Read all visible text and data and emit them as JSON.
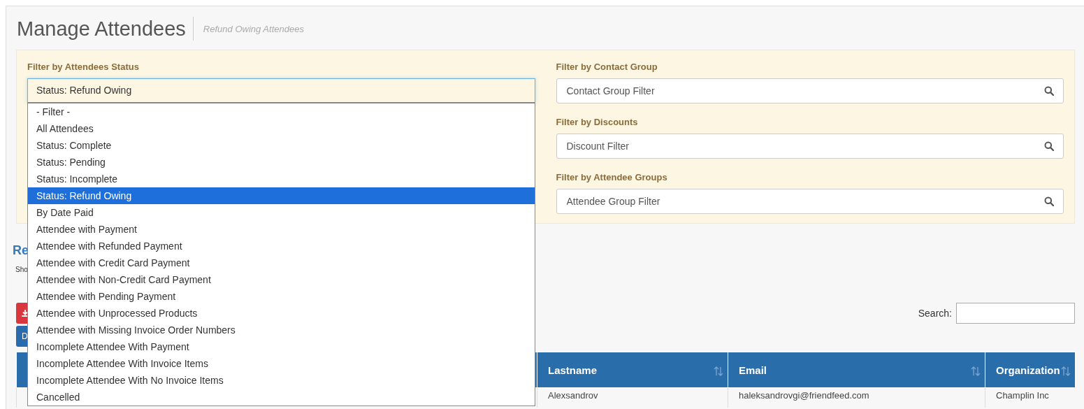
{
  "header": {
    "title": "Manage Attendees",
    "subtitle": "Refund Owing Attendees"
  },
  "filters": {
    "status": {
      "label": "Filter by Attendees Status",
      "value": "Status: Refund Owing",
      "expanded": true,
      "options": [
        {
          "label": "- Filter -",
          "selected": false
        },
        {
          "label": "All Attendees",
          "selected": false
        },
        {
          "label": "Status: Complete",
          "selected": false
        },
        {
          "label": "Status: Pending",
          "selected": false
        },
        {
          "label": "Status: Incomplete",
          "selected": false
        },
        {
          "label": "Status: Refund Owing",
          "selected": true
        },
        {
          "label": "By Date Paid",
          "selected": false
        },
        {
          "label": "Attendee with Payment",
          "selected": false
        },
        {
          "label": "Attendee with Refunded Payment",
          "selected": false
        },
        {
          "label": "Attendee with Credit Card Payment",
          "selected": false
        },
        {
          "label": "Attendee with Non-Credit Card Payment",
          "selected": false
        },
        {
          "label": "Attendee with Pending Payment",
          "selected": false
        },
        {
          "label": "Attendee with Unprocessed Products",
          "selected": false
        },
        {
          "label": "Attendee with Missing Invoice Order Numbers",
          "selected": false
        },
        {
          "label": "Incomplete Attendee With Payment",
          "selected": false
        },
        {
          "label": "Incomplete Attendee With Invoice Items",
          "selected": false
        },
        {
          "label": "Incomplete Attendee With No Invoice Items",
          "selected": false
        },
        {
          "label": "Cancelled",
          "selected": false
        }
      ]
    },
    "search_filters": [
      {
        "label": "Filter by Contact Group",
        "placeholder": "Contact Group Filter"
      },
      {
        "label": "Filter by Discounts",
        "placeholder": "Discount Filter"
      },
      {
        "label": "Filter by Attendee Groups",
        "placeholder": "Attendee Group Filter"
      }
    ]
  },
  "results": {
    "heading": "Re",
    "show_text": "Sho",
    "buttons": [
      {
        "kind": "danger"
      },
      {
        "kind": "primary",
        "label": "D"
      }
    ],
    "search_label": "Search:"
  },
  "table": {
    "columns": [
      "Lastname",
      "Email",
      "Organization"
    ],
    "rows": [
      {
        "cells": [
          {
            "kind": "text",
            "text": "Alexsandrov"
          },
          {
            "kind": "text",
            "text": "haleksandrovgi@friendfeed.com"
          },
          {
            "kind": "text",
            "text": "Champlin Inc"
          }
        ]
      }
    ]
  }
}
